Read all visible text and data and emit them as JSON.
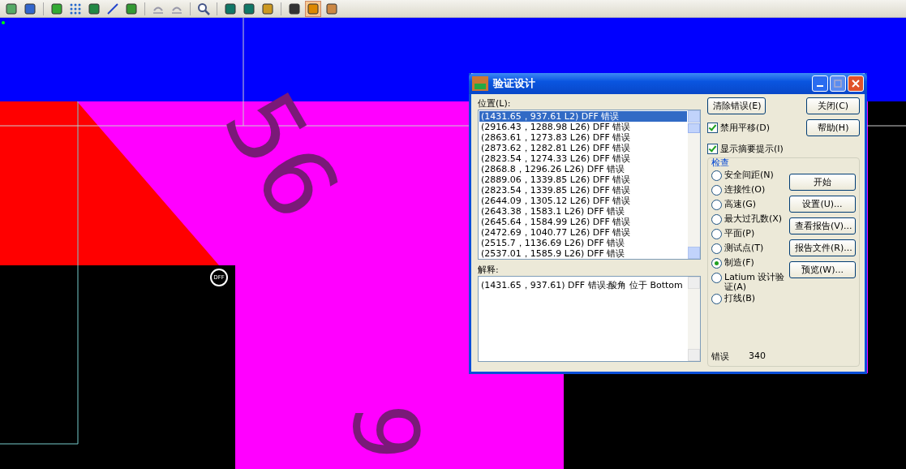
{
  "toolbar": [
    {
      "kind": "properties",
      "selected": false
    },
    {
      "kind": "refresh",
      "selected": false
    },
    {
      "kind": "sep"
    },
    {
      "kind": "layers",
      "selected": false
    },
    {
      "kind": "dots",
      "selected": false
    },
    {
      "kind": "board",
      "selected": false
    },
    {
      "kind": "line",
      "selected": false
    },
    {
      "kind": "chip",
      "selected": false
    },
    {
      "kind": "sep"
    },
    {
      "kind": "undo",
      "selected": false
    },
    {
      "kind": "redo",
      "selected": false
    },
    {
      "kind": "sep"
    },
    {
      "kind": "zoom",
      "selected": false
    },
    {
      "kind": "sep"
    },
    {
      "kind": "view",
      "selected": false
    },
    {
      "kind": "swap",
      "selected": false
    },
    {
      "kind": "brush",
      "selected": false
    },
    {
      "kind": "sep"
    },
    {
      "kind": "hammer",
      "selected": false
    },
    {
      "kind": "folder",
      "selected": true
    },
    {
      "kind": "pads",
      "selected": false
    }
  ],
  "board": {
    "labels": [
      "56",
      "9"
    ],
    "marker": "DFF"
  },
  "dialog": {
    "title": "验证设计",
    "location_label": "位置(L):",
    "locations": [
      {
        "text": "(1431.65，937.61 L2) DFF 错误",
        "selected": true
      },
      {
        "text": "(2916.43，1288.98 L26) DFF 错误",
        "selected": false
      },
      {
        "text": "(2863.61，1273.83 L26) DFF 错误",
        "selected": false
      },
      {
        "text": "(2873.62，1282.81 L26) DFF 错误",
        "selected": false
      },
      {
        "text": "(2823.54，1274.33 L26) DFF 错误",
        "selected": false
      },
      {
        "text": "(2868.8，1296.26 L26) DFF 错误",
        "selected": false
      },
      {
        "text": "(2889.06，1339.85 L26) DFF 错误",
        "selected": false
      },
      {
        "text": "(2823.54，1339.85 L26) DFF 错误",
        "selected": false
      },
      {
        "text": "(2644.09，1305.12 L26) DFF 错误",
        "selected": false
      },
      {
        "text": "(2643.38，1583.1 L26) DFF 错误",
        "selected": false
      },
      {
        "text": "(2645.64，1584.99 L26) DFF 错误",
        "selected": false
      },
      {
        "text": "(2472.69，1040.77 L26) DFF 错误",
        "selected": false
      },
      {
        "text": "(2515.7，1136.69 L26) DFF 错误",
        "selected": false
      },
      {
        "text": "(2537.01，1585.9 L26) DFF 错误",
        "selected": false
      }
    ],
    "explanation_label": "解释:",
    "explanation": "(1431.65，937.61) DFF 错误:酸角 位于 Bottom",
    "clear_button": "清除错误(E)",
    "close_button": "关闭(C)",
    "help_button": "帮助(H)",
    "options": [
      {
        "label": "禁用平移(D)",
        "checked": true
      },
      {
        "label": "显示摘要提示(I)",
        "checked": true
      }
    ],
    "check_group": "检查",
    "checks": [
      {
        "label": "安全间距(N)",
        "selected": false
      },
      {
        "label": "连接性(O)",
        "selected": false
      },
      {
        "label": "高速(G)",
        "selected": false
      },
      {
        "label": "最大过孔数(X)",
        "selected": false
      },
      {
        "label": "平面(P)",
        "selected": false
      },
      {
        "label": "测试点(T)",
        "selected": false
      },
      {
        "label": "制造(F)",
        "selected": true
      },
      {
        "label": "Latium 设计验证(A)",
        "selected": false
      },
      {
        "label": "打线(B)",
        "selected": false
      }
    ],
    "actions": [
      "开始",
      "设置(U)...",
      "查看报告(V)...",
      "报告文件(R)...",
      "预览(W)..."
    ],
    "error_label": "错误",
    "error_count": "340"
  }
}
